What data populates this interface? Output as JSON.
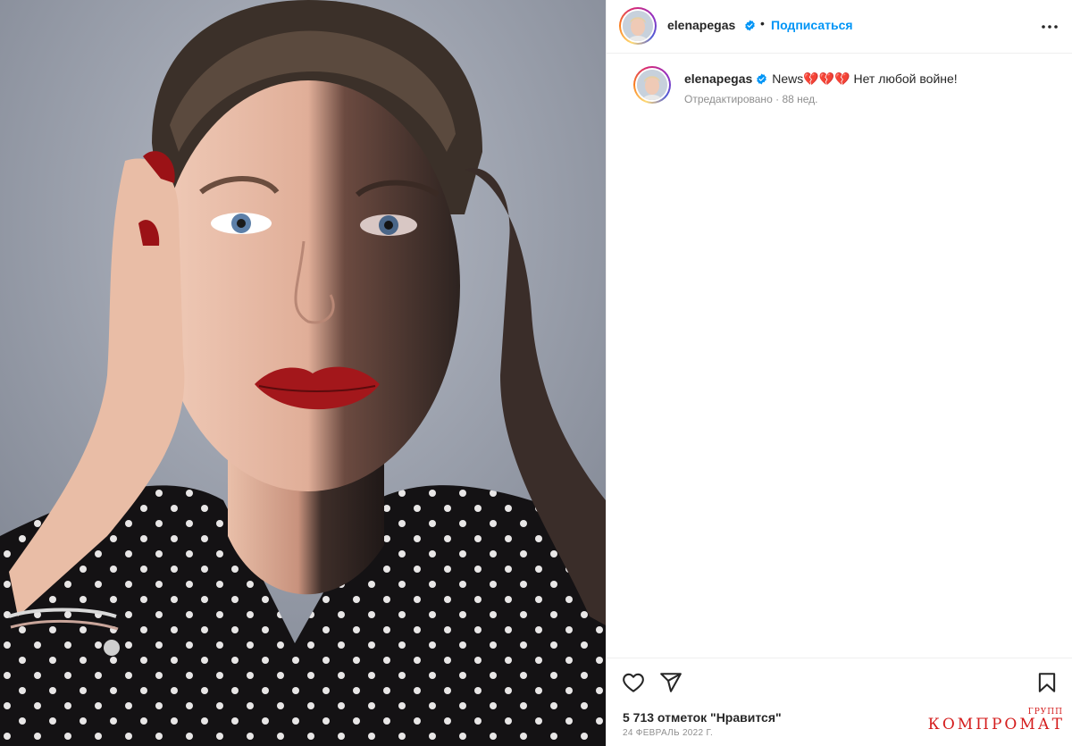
{
  "post": {
    "username": "elenapegas",
    "follow_label": "Подписаться",
    "separator": "•",
    "verified_icon": "verified-badge-icon",
    "more_icon": "more-options-icon",
    "caption_text": "News💔💔💔 Нет любой войне!",
    "edited_label": "Отредактировано",
    "age": "88 нед.",
    "likes_label": "5 713 отметок \"Нравится\"",
    "date": "24 февраль 2022 г.",
    "like_icon": "heart-icon",
    "share_icon": "share-icon",
    "save_icon": "bookmark-icon"
  },
  "watermark": {
    "main": "КОМПРОМАТ",
    "small": "ГРУПП"
  },
  "colors": {
    "accent": "#0095f6",
    "verified": "#0095f6",
    "text": "#262626",
    "muted": "#8e8e8e",
    "watermark": "#d41c1c"
  }
}
